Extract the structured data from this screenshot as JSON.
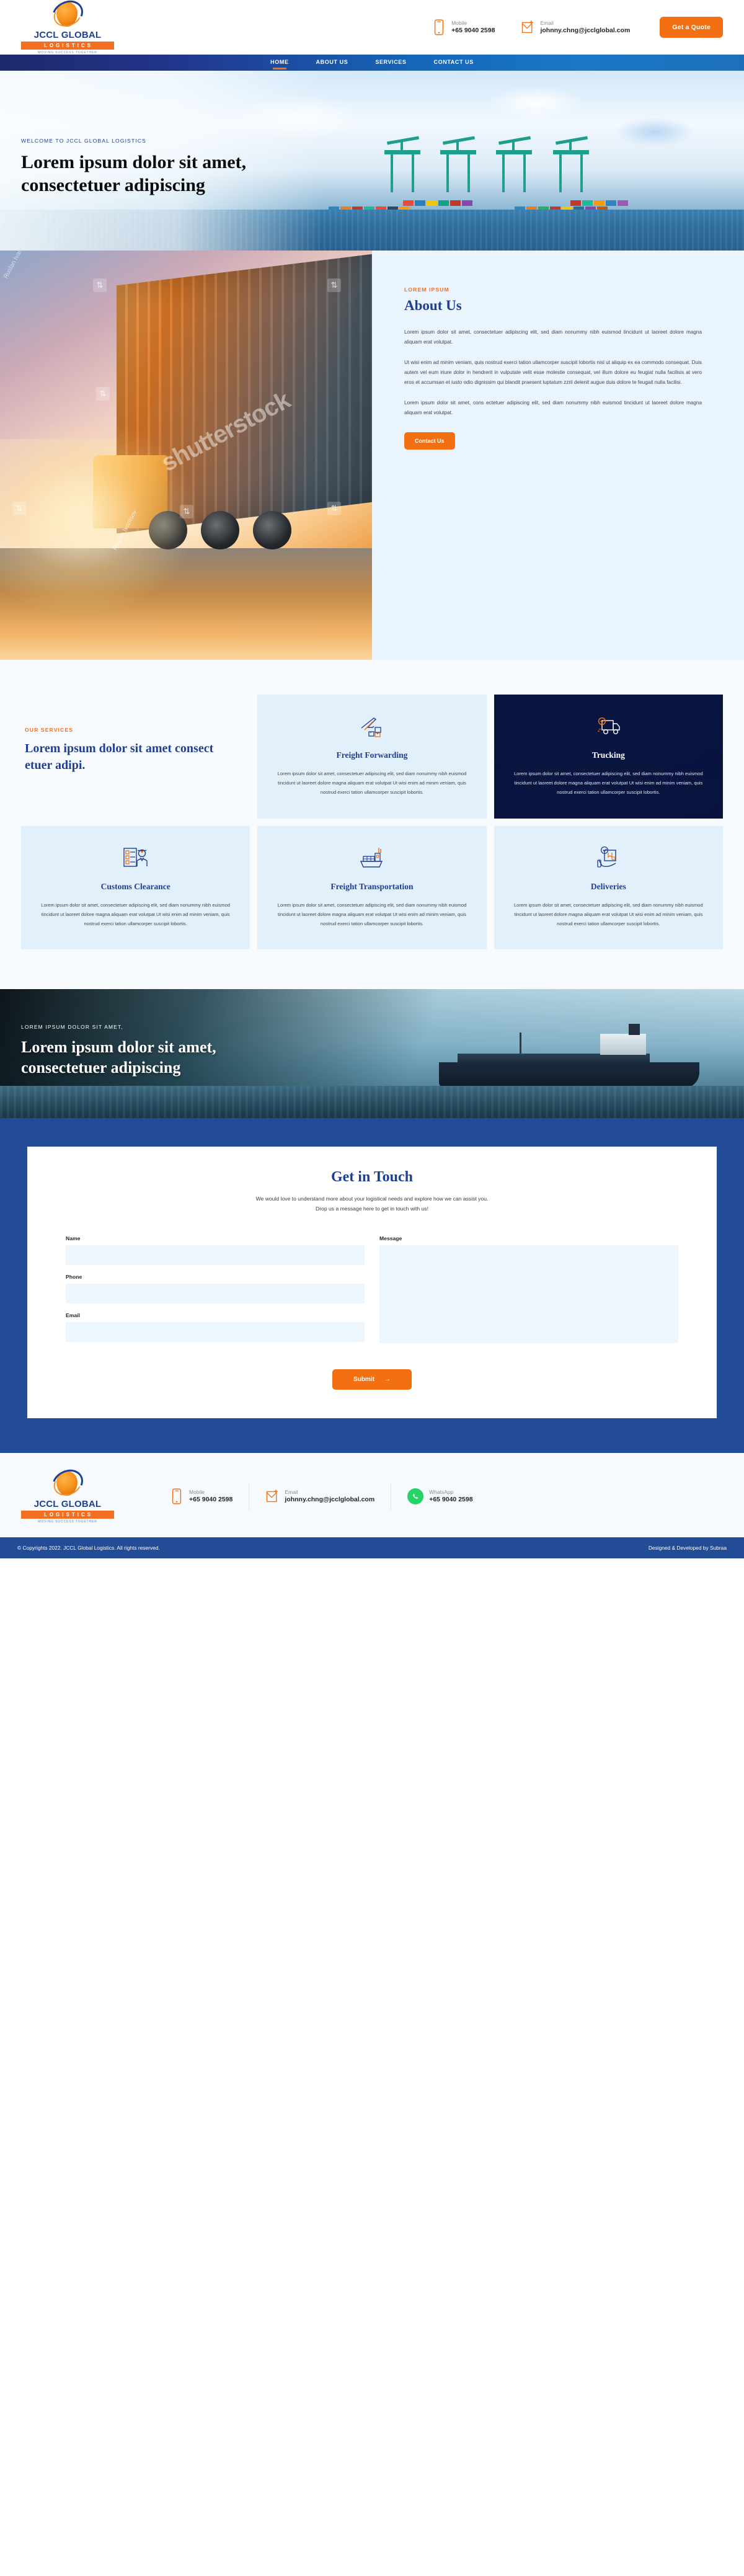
{
  "brand": {
    "name": "JCCL GLOBAL",
    "sub": "LOGISTICS",
    "tagline": "MOVING SUCCESS TOGETHER",
    "accent_orange": "#f37012",
    "accent_blue": "#1f3f91",
    "nav_blue_dark": "#1d2a6b",
    "nav_blue_light": "#1a78c6",
    "form_band_blue": "#234c96"
  },
  "topbar": {
    "mobile_label": "Mobile",
    "mobile_value": "+65 9040 2598",
    "email_label": "Email",
    "email_value": "johnny.chng@jcclglobal.com",
    "quote_button": "Get a Quote"
  },
  "nav": {
    "items": [
      {
        "label": "HOME",
        "active": true
      },
      {
        "label": "ABOUT US",
        "active": false
      },
      {
        "label": "SERVICES",
        "active": false
      },
      {
        "label": "CONTACT US",
        "active": false
      }
    ]
  },
  "hero": {
    "eyebrow": "WELCOME TO JCCL GLOBAL LOGISTICS",
    "title": "Lorem ipsum dolor sit amet, consectetuer adipiscing",
    "image_alt": "container-port-cranes-photo"
  },
  "about": {
    "kicker": "LOREM IPSUM",
    "heading": "About Us",
    "paragraphs": [
      "Lorem ipsum dolor sit amet, consectetuer adipiscing elit, sed diam nonummy nibh euismod tincidunt ut laoreet dolore magna aliquam erat volutpat.",
      "Ut wisi enim ad minim veniam, quis nostrud exerci tation ullamcorper suscipit lobortis nisl ut aliquip ex ea commodo consequat. Duis autem vel eum iriure dolor in hendrerit in vulputate velit esse molestie consequat, vel illum dolore eu feugiat nulla facilisis at vero eros et accumsan et iusto odio dignissim qui blandit praesent luptatum zzril delenit augue duis dolore te feugait nulla facilisi.",
      "Lorem ipsum dolor sit amet, cons ectetuer adipiscing elit, sed diam nonummy nibh euismod tincidunt ut laoreet dolore magna aliquam erat volutpat."
    ],
    "button": "Contact Us",
    "image_alt": "truck-on-highway-sunset-photo",
    "watermarks": [
      "Ruslan Ivantsov",
      "shutterstock",
      "Ruslan Ivantsov"
    ]
  },
  "services": {
    "kicker": "OUR SERVICES",
    "heading": "Lorem ipsum dolor sit amet consect etuer adipi.",
    "body_text": "Lorem ipsum dolor sit amet, consectetuer adipiscing elit, sed diam nonummy nibh euismod tincidunt ut laoreet dolore magna aliquam erat volutpat Ut wisi enim ad minim veniam, quis nostrud exerci tation ullamcorper suscipit lobortis.",
    "cards": [
      {
        "title": "Freight Forwarding",
        "icon": "airplane-cargo-icon",
        "dark": false
      },
      {
        "title": "Trucking",
        "icon": "truck-clock-icon",
        "dark": true
      },
      {
        "title": "Customs Clearance",
        "icon": "checklist-officer-icon",
        "dark": false
      },
      {
        "title": "Freight Transportation",
        "icon": "cargo-ship-icon",
        "dark": false
      },
      {
        "title": "Deliveries",
        "icon": "package-in-hand-icon",
        "dark": false
      }
    ]
  },
  "banner2": {
    "eyebrow": "LOREM IPSUM DOLOR SIT AMET,",
    "title": "Lorem ipsum dolor sit amet, consectetuer adipiscing",
    "image_alt": "cargo-ship-at-sea-photo"
  },
  "form": {
    "heading": "Get in Touch",
    "subtitle_line1": "We would love to understand more about your logistical needs and explore how we can assist you.",
    "subtitle_line2": "Drop us a message here to get in touch with us!",
    "fields": [
      {
        "label": "Name",
        "value": "",
        "placeholder": ""
      },
      {
        "label": "Phone",
        "value": "",
        "placeholder": ""
      },
      {
        "label": "Email",
        "value": "",
        "placeholder": ""
      }
    ],
    "message_label": "Message",
    "message_value": "",
    "message_placeholder": "",
    "submit": "Submit",
    "submit_arrow": "→"
  },
  "footer": {
    "mobile_label": "Mobile",
    "mobile_value": "+65 9040 2598",
    "email_label": "Email",
    "email_value": "johnny.chng@jcclglobal.com",
    "whatsapp_label": "WhatsApp",
    "whatsapp_value": "+65 9040 2598",
    "copyright": "© Copyrights 2022. JCCL Global Logistics. All rights reserved.",
    "credit": "Designed & Developed by Subraa"
  }
}
